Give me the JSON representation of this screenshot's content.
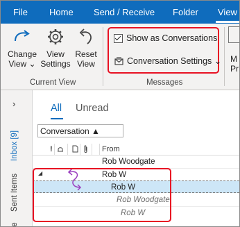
{
  "tabs": [
    {
      "label": "File"
    },
    {
      "label": "Home"
    },
    {
      "label": "Send / Receive"
    },
    {
      "label": "Folder"
    },
    {
      "label": "View"
    }
  ],
  "ribbon": {
    "change_view": {
      "line1": "Change",
      "line2": "View ⌄"
    },
    "view_settings": {
      "line1": "View",
      "line2": "Settings"
    },
    "reset_view": {
      "line1": "Reset",
      "line2": "View"
    },
    "current_view_label": "Current View",
    "show_as_conversations": "Show as Conversations",
    "show_as_conversations_checked": true,
    "conversation_settings": "Conversation Settings ⌄",
    "messages_label": "Messages",
    "cut_off_1": "M",
    "cut_off_2": "Pr"
  },
  "sidebar": {
    "inbox": "Inbox [9]",
    "sent": "Sent Items",
    "more": "ive"
  },
  "list": {
    "filter_all": "All",
    "filter_unread": "Unread",
    "arrange_by": "Conversation ▲",
    "header_from": "From",
    "header_icons": "!",
    "rows": [
      {
        "text": "Rob Woodgate"
      },
      {
        "text": "Rob W"
      },
      {
        "text": "Rob W"
      },
      {
        "text": "Rob Woodgate"
      },
      {
        "text": "Rob W"
      }
    ]
  },
  "colors": {
    "accent": "#0f6cbd",
    "highlight": "#e81123",
    "selected_row": "#cde6f7",
    "conversation_arrow": "#9b3fbf"
  }
}
